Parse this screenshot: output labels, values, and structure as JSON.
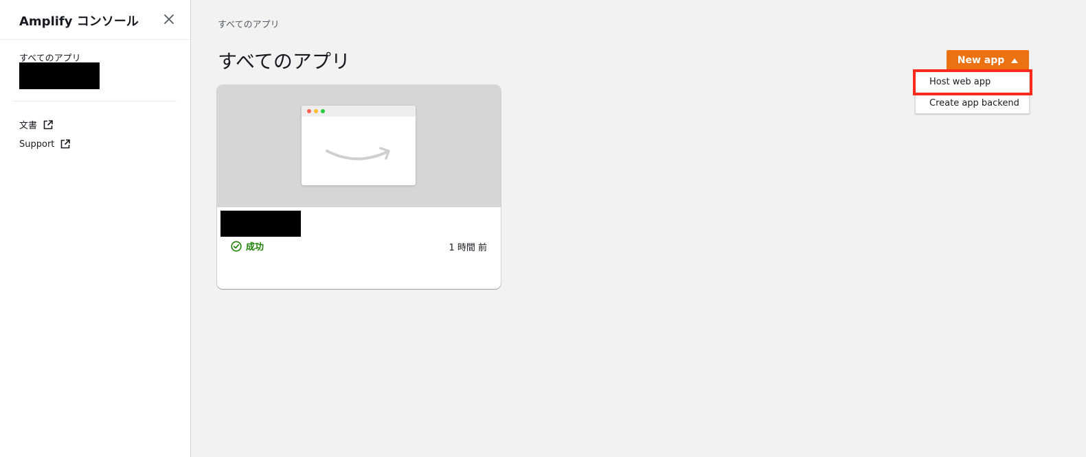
{
  "sidebar": {
    "title": "Amplify コンソール",
    "section_label": "すべてのアプリ",
    "links": [
      {
        "label": "文書",
        "icon": "external-link-icon"
      },
      {
        "label": "Support",
        "icon": "external-link-icon"
      }
    ]
  },
  "main": {
    "breadcrumb": "すべてのアプリ",
    "title": "すべてのアプリ",
    "new_app_button": {
      "label": "New app",
      "icon": "caret-up-icon"
    },
    "dropdown": {
      "items": [
        {
          "label": "Host web app",
          "highlighted": true
        },
        {
          "label": "Create app backend",
          "highlighted": false
        }
      ]
    },
    "app_card": {
      "status": "成功",
      "time_ago": "1 時間 前"
    }
  },
  "colors": {
    "accent": "#ec7211",
    "success": "#1d8102",
    "highlight": "#ff2a1a"
  }
}
